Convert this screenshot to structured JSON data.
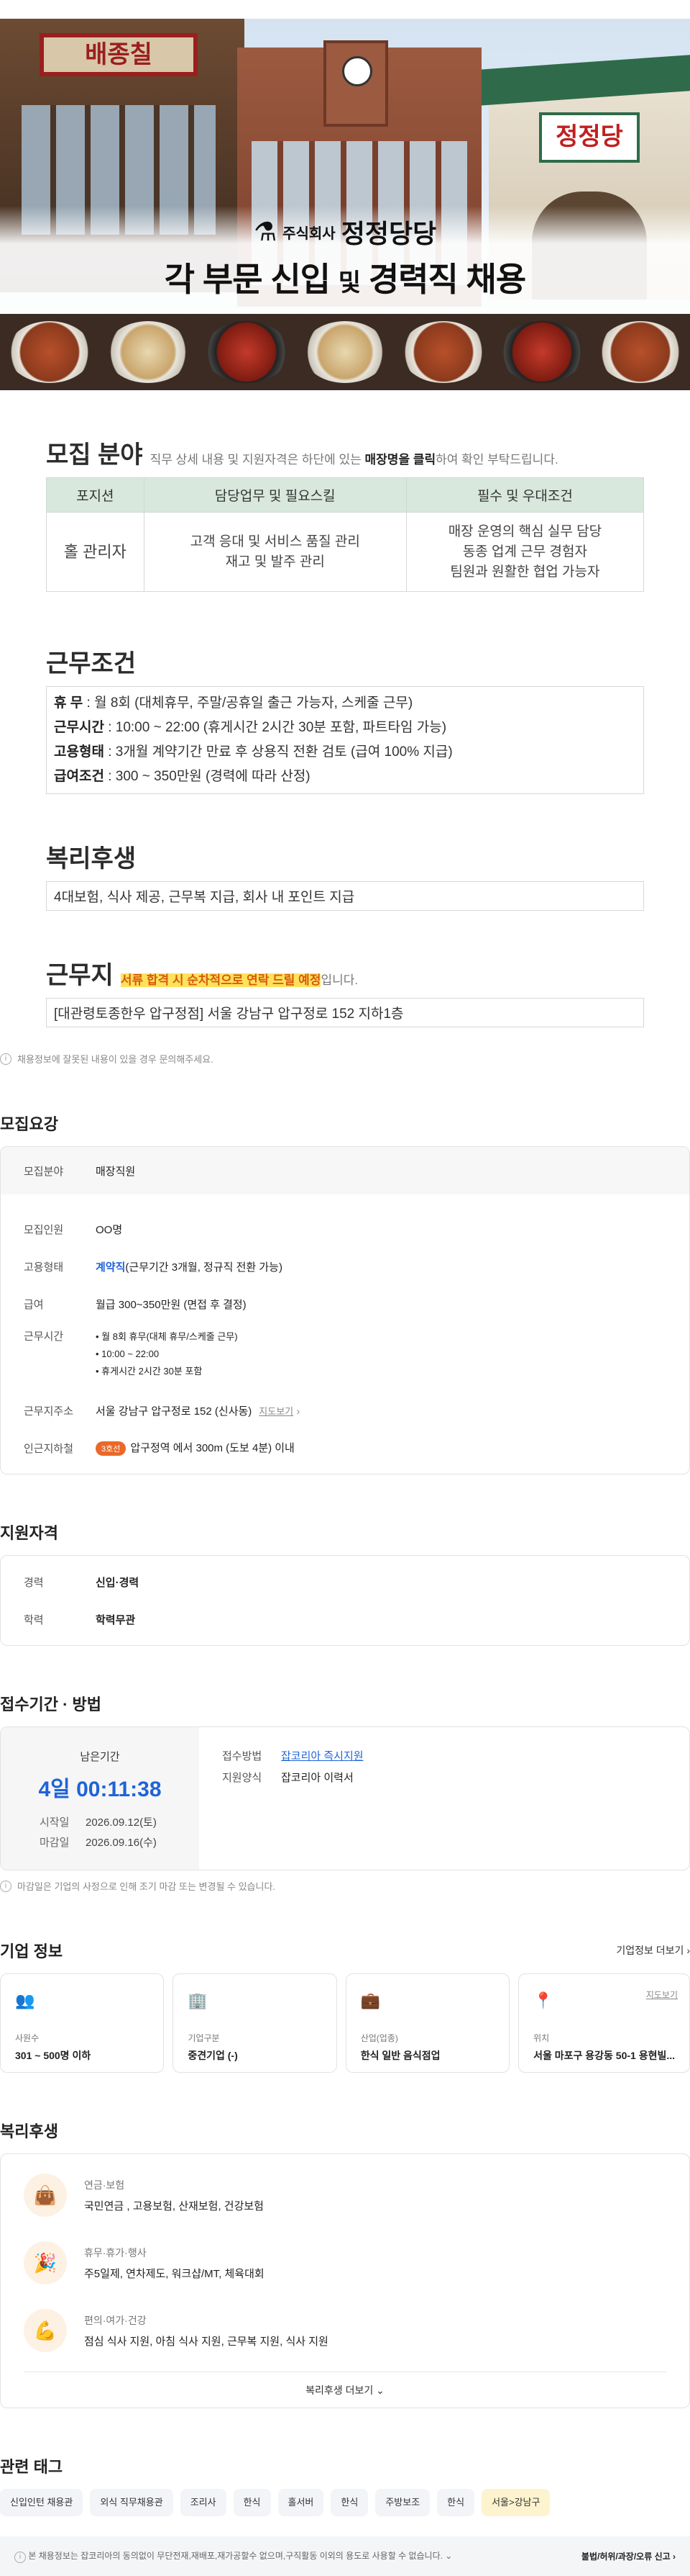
{
  "banner": {
    "company_prefix": "주식회사",
    "company_name": "정정당당",
    "headline_part1": "각 부문 신입",
    "headline_part2": "및",
    "headline_part3": "경력직 채용",
    "sign_left": "배종칠",
    "sign_right": "정정당"
  },
  "poster": {
    "field": {
      "title": "모집 분야",
      "desc_pre": "직무 상세 내용 및 지원자격은 하단에 있는 ",
      "desc_bold": "매장명을 클릭",
      "desc_post": "하여 확인 부탁드립니다.",
      "headers": [
        "포지션",
        "담당업무 및 필요스킬",
        "필수 및 우대조건"
      ],
      "position": "홀 관리자",
      "duties": [
        "고객 응대 및 서비스 품질 관리",
        "재고 및 발주 관리"
      ],
      "requirements": [
        "매장 운영의 핵심 실무 담당",
        "동종 업계 근무 경험자",
        "팀원과 원활한 협업 가능자"
      ]
    },
    "conditions": {
      "title": "근무조건",
      "rows": [
        {
          "k": "휴        무",
          "v": "월 8회 (대체휴무, 주말/공휴일 출근 가능자, 스케줄 근무)"
        },
        {
          "k": "근무시간",
          "v": "10:00 ~ 22:00 (휴게시간 2시간 30분 포함, 파트타임 가능)"
        },
        {
          "k": "고용형태",
          "v": "3개월 계약기간 만료 후 상용직 전환 검토 (급여 100% 지급)"
        },
        {
          "k": "급여조건",
          "v": "300 ~ 350만원 (경력에 따라 산정)"
        }
      ]
    },
    "welfare": {
      "title": "복리후생",
      "text": "4대보험, 식사 제공, 근무복 지급, 회사 내 포인트 지급"
    },
    "location": {
      "title": "근무지",
      "hl": "서류 합격 시 순차적으로 연락 드릴 예정",
      "hl_post": "입니다.",
      "text": "[대관령토종한우 압구정점] 서울 강남구 압구정로 152 지하1층"
    }
  },
  "notice": "채용정보에 잘못된 내용이 있을 경우 문의해주세요.",
  "recruit": {
    "title": "모집요강",
    "field_k": "모집분야",
    "field_v": "매장직원",
    "count_k": "모집인원",
    "count_v": "OO명",
    "type_k": "고용형태",
    "type_v_blue": "계약직",
    "type_v": "(근무기간 3개월, 정규직 전환 가능)",
    "pay_k": "급여",
    "pay_v": "월급 300~350만원 (면접 후 결정)",
    "hours_k": "근무시간",
    "hours_v": [
      "월 8회 휴무(대체 휴무/스케줄 근무)",
      "10:00 ~ 22:00",
      "휴게시간 2시간 30분 포함"
    ],
    "addr_k": "근무지주소",
    "addr_v": "서울 강남구 압구정로 152 (신사동)",
    "addr_link": "지도보기",
    "subway_k": "인근지하철",
    "subway_badge": "3호선",
    "subway_v": "압구정역 에서 300m (도보 4분) 이내"
  },
  "qualification": {
    "title": "지원자격",
    "career_k": "경력",
    "career_v": "신입·경력",
    "edu_k": "학력",
    "edu_v": "학력무관"
  },
  "period": {
    "title": "접수기간 · 방법",
    "remain_label": "남은기간",
    "timer": "4일 00:11:38",
    "start_k": "시작일",
    "start_v": "2026.09.12(토)",
    "end_k": "마감일",
    "end_v": "2026.09.16(수)",
    "method_k": "접수방법",
    "method_v": "잡코리아 즉시지원",
    "form_k": "지원양식",
    "form_v": "잡코리아 이력서",
    "note": "마감일은 기업의 사정으로 인해 조기 마감 또는 변경될 수 있습니다."
  },
  "company": {
    "title": "기업 정보",
    "more": "기업정보 더보기",
    "cards": [
      {
        "icon": "people-icon",
        "label": "사원수",
        "value": "301 ~ 500명 이하"
      },
      {
        "icon": "building-icon",
        "label": "기업구분",
        "value": "중견기업 (-)"
      },
      {
        "icon": "briefcase-icon",
        "label": "산업(업종)",
        "value": "한식 일반 음식점업"
      },
      {
        "icon": "pin-icon",
        "label": "위치",
        "value": "서울 마포구 용강동 50-1 용현빌...",
        "link": "지도보기"
      }
    ]
  },
  "benefits": {
    "title": "복리후생",
    "items": [
      {
        "icon": "shopping-bag-icon",
        "title": "연금·보험",
        "value": "국민연금 , 고용보험, 산재보험, 건강보험"
      },
      {
        "icon": "party-icon",
        "title": "휴무·휴가·행사",
        "value": "주5일제, 연차제도, 워크샵/MT, 체육대회"
      },
      {
        "icon": "muscle-icon",
        "title": "편의·여가·건강",
        "value": "점심 식사 지원, 아침 식사 지원, 근무복 지원, 식사 지원"
      }
    ],
    "more": "복리후생 더보기"
  },
  "tags": {
    "title": "관련 태그",
    "items": [
      "신입인턴 채용관",
      "외식 직무채용관",
      "조리사",
      "한식",
      "홀서버",
      "한식",
      "주방보조",
      "한식",
      "서울>강남구"
    ]
  },
  "footer": {
    "left": "본 채용정보는 잡코리아의 동의없이 무단전재,재배포,재가공할수 없으며,구직활동 이외의 용도로 사용할 수 없습니다.",
    "right": "불법/허위/과장/오류 신고"
  },
  "colors": {
    "accent": "#1f63d8",
    "highlight": "#ffe25a",
    "table_head": "#d9e8dc",
    "subway": "#e8692a"
  }
}
